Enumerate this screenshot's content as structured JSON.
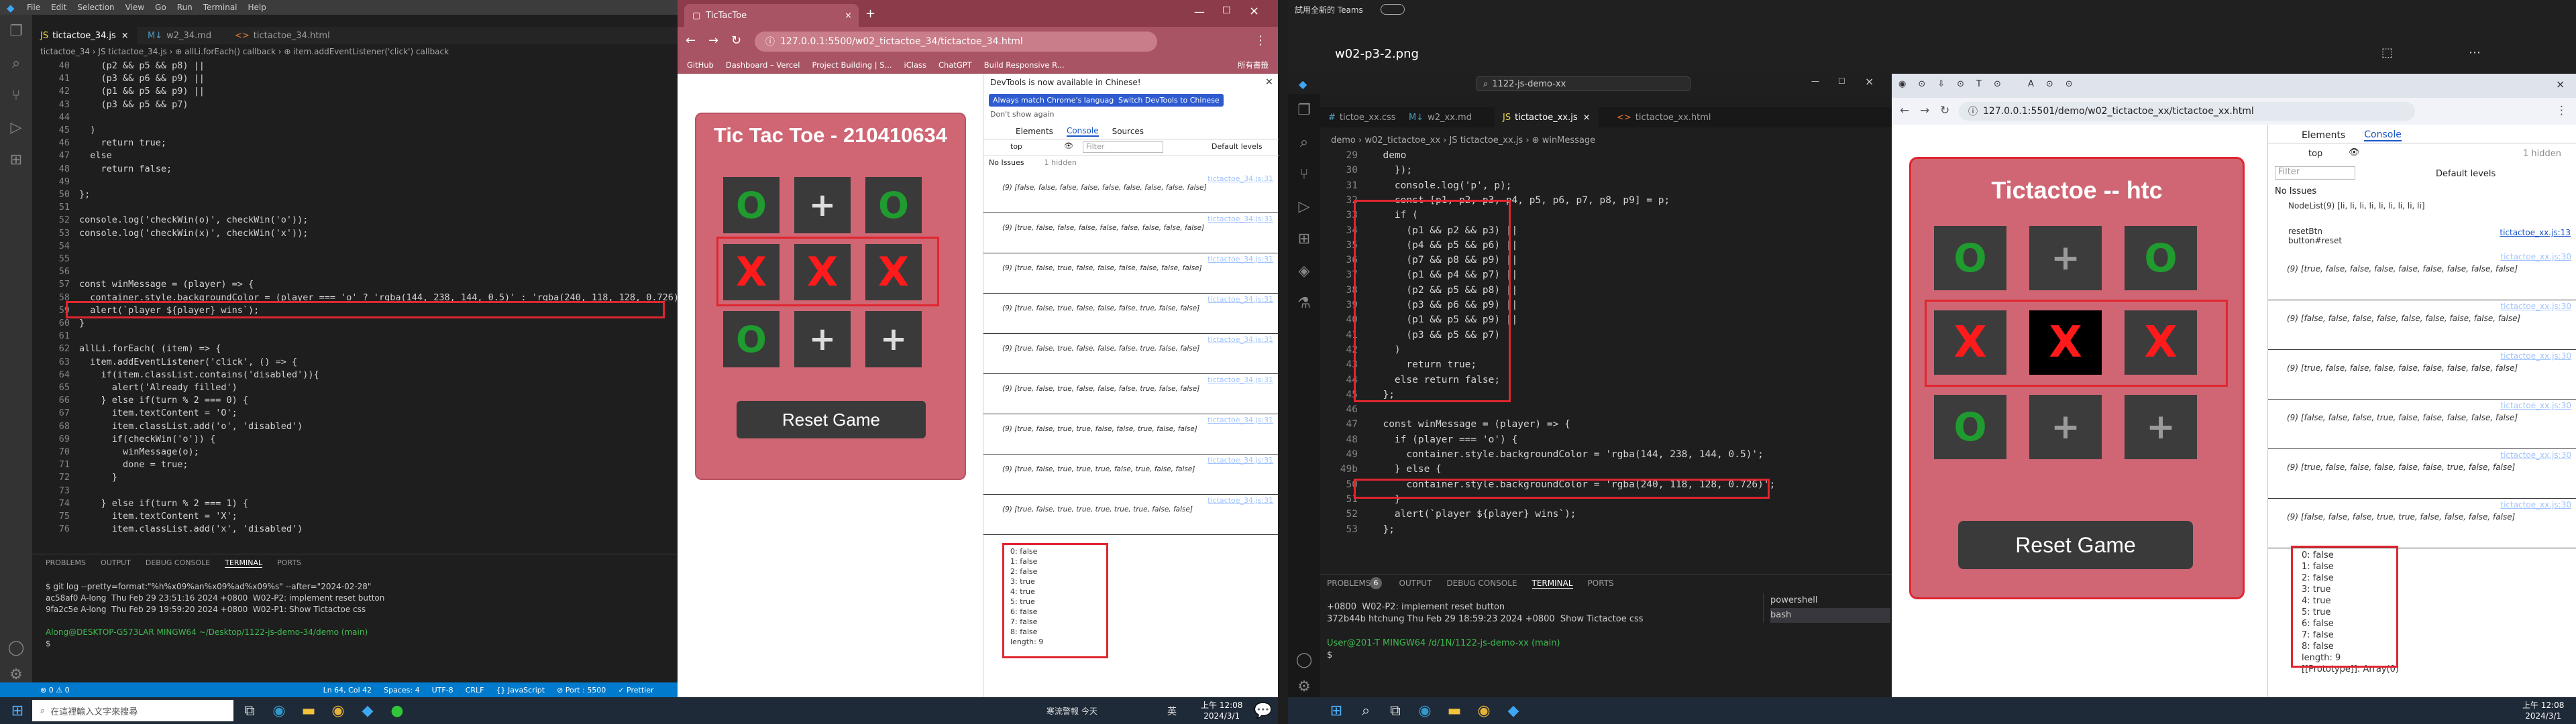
{
  "left_vscode": {
    "menu": [
      "File",
      "Edit",
      "Selection",
      "View",
      "Go",
      "Run",
      "Terminal",
      "Help"
    ],
    "tabs": [
      "tictactoe_34.js",
      "w2_34.md",
      "tictactoe_34.html"
    ],
    "breadcrumb": "tictactoe_34 › JS tictactoe_34.js › ⊕ allLi.forEach() callback › ⊕ item.addEventListener('click') callback",
    "code": [
      {
        "n": "40",
        "t": "    (p2 && p5 && p8) ||"
      },
      {
        "n": "41",
        "t": "    (p3 && p6 && p9) ||"
      },
      {
        "n": "42",
        "t": "    (p1 && p5 && p9) ||"
      },
      {
        "n": "43",
        "t": "    (p3 && p5 && p7)"
      },
      {
        "n": "44",
        "t": ""
      },
      {
        "n": "45",
        "t": "  ) "
      },
      {
        "n": "46",
        "t": "    return true;"
      },
      {
        "n": "47",
        "t": "  else"
      },
      {
        "n": "48",
        "t": "    return false;"
      },
      {
        "n": "49",
        "t": ""
      },
      {
        "n": "50",
        "t": "};"
      },
      {
        "n": "51",
        "t": ""
      },
      {
        "n": "52",
        "t": "console.log('checkWin(o)', checkWin('o'));"
      },
      {
        "n": "53",
        "t": "console.log('checkWin(x)', checkWin('x'));"
      },
      {
        "n": "54",
        "t": ""
      },
      {
        "n": "55",
        "t": ""
      },
      {
        "n": "56",
        "t": ""
      },
      {
        "n": "57",
        "t": "const winMessage = (player) => {"
      },
      {
        "n": "58",
        "t": "  container.style.backgroundColor = (player === 'o' ? 'rgba(144, 238, 144, 0.5)' : 'rgba(240, 118, 128, 0.726)'"
      },
      {
        "n": "59",
        "t": "  alert(`player ${player} wins`);"
      },
      {
        "n": "60",
        "t": "}"
      },
      {
        "n": "61",
        "t": ""
      },
      {
        "n": "62",
        "t": "allLi.forEach( (item) => {"
      },
      {
        "n": "63",
        "t": "  item.addEventListener('click', () => {"
      },
      {
        "n": "64",
        "t": "    if(item.classList.contains('disabled')){"
      },
      {
        "n": "65",
        "t": "      alert('Already filled')"
      },
      {
        "n": "66",
        "t": "    } else if(turn % 2 === 0) {"
      },
      {
        "n": "67",
        "t": "      item.textContent = 'O';"
      },
      {
        "n": "68",
        "t": "      item.classList.add('o', 'disabled')"
      },
      {
        "n": "69",
        "t": "      if(checkWin('o')) {"
      },
      {
        "n": "70",
        "t": "        winMessage(o);"
      },
      {
        "n": "71",
        "t": "        done = true;"
      },
      {
        "n": "72",
        "t": "      }"
      },
      {
        "n": "73",
        "t": ""
      },
      {
        "n": "74",
        "t": "    } else if(turn % 2 === 1) {"
      },
      {
        "n": "75",
        "t": "      item.textContent = 'X';"
      },
      {
        "n": "76",
        "t": "      item.classList.add('x', 'disabled')"
      }
    ],
    "panel_tabs": [
      "PROBLEMS",
      "OUTPUT",
      "DEBUG CONSOLE",
      "TERMINAL",
      "PORTS"
    ],
    "terminal": [
      "$ git log --pretty=format:\"%h%x09%an%x09%ad%x09%s\" --after=\"2024-02-28\"",
      "ac58af0 A-long  Thu Feb 29 23:51:16 2024 +0800  W02-P2: implement reset button",
      "9fa2c5e A-long  Thu Feb 29 19:59:20 2024 +0800  W02-P1: Show Tictactoe css",
      "",
      "Along@DESKTOP-G573LAR MINGW64 ~/Desktop/1122-js-demo-34/demo (main)",
      "$ "
    ],
    "status": [
      "⊗ 0 ⚠ 0",
      "Ln 64, Col 42",
      "Spaces: 4",
      "UTF-8",
      "CRLF",
      "{} JavaScript",
      "⊘ Port : 5500",
      "✓ Prettier"
    ]
  },
  "left_browser": {
    "tab_title": "TicTacToe",
    "url": "127.0.0.1:5500/w02_tictactoe_34/tictactoe_34.html",
    "bookmarks": [
      "GitHub",
      "Dashboard – Vercel",
      "Project Building | S...",
      "iClass",
      "ChatGPT",
      "Build Responsive R..."
    ],
    "bookmark_folder": "所有書籤",
    "game_title": "Tic Tac Toe - 210410634",
    "board": [
      "o",
      "p",
      "o",
      "x",
      "x",
      "x",
      "o",
      "p",
      "p"
    ],
    "reset_label": "Reset Game",
    "devtools_notice": "DevTools is now available in Chinese!",
    "devtools_btn1": "Always match Chrome's language",
    "devtools_btn2": "Switch DevTools to Chinese",
    "devtools_dont": "Don't show again",
    "devtools_tabs": [
      "Elements",
      "Console",
      "Sources"
    ],
    "filter_placeholder": "Filter",
    "default_levels": "Default levels",
    "no_issues": "No Issues",
    "hidden": "1 hidden",
    "top": "top",
    "source": "tictactoe_34.js:31",
    "logs": [
      "(9) [false, false, false, false, false, false, false, false, false]",
      "(9) [true, false, false, false, false, false, false, false, false]",
      "(9) [true, false, true, false, false, false, false, false, false]",
      "(9) [true, false, true, false, false, false, true, false, false]",
      "(9) [true, false, true, false, false, false, true, false, false]",
      "(9) [true, false, true, false, false, false, true, false, false]",
      "(9) [true, false, true, true, false, false, true, false, false]",
      "(9) [true, false, true, true, true, false, true, false, false]",
      "(9) [true, false, true, true, true, true, true, false, false]"
    ],
    "expanded": [
      "0: false",
      "1: false",
      "2: false",
      "3: true",
      "4: true",
      "5: true",
      "6: false",
      "7: false",
      "8: false",
      "length: 9"
    ]
  },
  "right_vscode": {
    "title": "w02-p3-2.png",
    "search": "1122-js-demo-xx",
    "tabs": [
      "tictoe_xx.css",
      "w2_xx.md",
      "tictactoe_xx.js",
      "tictactoe_xx.html"
    ],
    "breadcrumb": "demo › w02_tictactoe_xx › JS tictactoe_xx.js › ⊕ winMessage",
    "code": [
      {
        "n": "29",
        "t": "  demo"
      },
      {
        "n": "30",
        "t": "    });"
      },
      {
        "n": "31",
        "t": "    console.log('p', p);"
      },
      {
        "n": "32",
        "t": "    const [p1, p2, p3, p4, p5, p6, p7, p8, p9] = p;"
      },
      {
        "n": "33",
        "t": "    if ("
      },
      {
        "n": "34",
        "t": "      (p1 && p2 && p3) ||"
      },
      {
        "n": "35",
        "t": "      (p4 && p5 && p6) ||"
      },
      {
        "n": "36",
        "t": "      (p7 && p8 && p9) ||"
      },
      {
        "n": "37",
        "t": "      (p1 && p4 && p7) ||"
      },
      {
        "n": "38",
        "t": "      (p2 && p5 && p8) ||"
      },
      {
        "n": "39",
        "t": "      (p3 && p6 && p9) ||"
      },
      {
        "n": "40",
        "t": "      (p1 && p5 && p9) ||"
      },
      {
        "n": "41",
        "t": "      (p3 && p5 && p7)"
      },
      {
        "n": "42",
        "t": "    )"
      },
      {
        "n": "43",
        "t": "      return true;"
      },
      {
        "n": "44",
        "t": "    else return false;"
      },
      {
        "n": "45",
        "t": "  };"
      },
      {
        "n": "46",
        "t": ""
      },
      {
        "n": "47",
        "t": "  const winMessage = (player) => {"
      },
      {
        "n": "48",
        "t": "    if (player === 'o') {"
      },
      {
        "n": "49",
        "t": "      container.style.backgroundColor = 'rgba(144, 238, 144, 0.5)';"
      },
      {
        "n": "49b",
        "t": "    } else {"
      },
      {
        "n": "50",
        "t": "      container.style.backgroundColor = 'rgba(240, 118, 128, 0.726)';"
      },
      {
        "n": "51",
        "t": "    }"
      },
      {
        "n": "52",
        "t": "    alert(`player ${player} wins`);"
      },
      {
        "n": "53",
        "t": "  };"
      }
    ],
    "panel_tabs": [
      "PROBLEMS",
      "OUTPUT",
      "DEBUG CONSOLE",
      "TERMINAL",
      "PORTS"
    ],
    "problems_count": "6",
    "terminal": [
      "+0800  W02-P2: implement reset button",
      "372b44b htchung Thu Feb 29 18:59:23 2024 +0800  Show Tictactoe css",
      "",
      "User@201-T MINGW64 /d/1N/1122-js-demo-xx (main)",
      "$ "
    ],
    "shells": [
      "powershell",
      "bash"
    ]
  },
  "right_browser": {
    "url": "127.0.0.1:5501/demo/w02_tictactoe_xx/tictactoe_xx.html",
    "game_title": "Tictactoe -- htc",
    "board": [
      "o",
      "p",
      "o",
      "x",
      "x",
      "x",
      "o",
      "p",
      "p"
    ],
    "reset_label": "Reset Game",
    "devtools_tabs": [
      "Elements",
      "Console"
    ],
    "filter_placeholder": "Filter",
    "default_levels": "Default levels",
    "hidden": "1 hidden",
    "no_issues": "No Issues",
    "top": "top",
    "reset_label_log": "resetBtn",
    "reset_log2": "button#reset",
    "source": "tictactoe_xx.js:30",
    "source13": "tictactoe_xx.js:13",
    "first_log": "NodeList(9) [li, li, li, li, li, li, li, li, li]",
    "logs": [
      "(9) [true, false, false, false, false, false, false, false, false]",
      "(9) [false, false, false, false, false, false, false, false, false]",
      "(9) [true, false, false, false, false, false, false, false, false]",
      "(9) [false, false, false, true, false, false, false, false, false]",
      "(9) [true, false, false, false, false, false, true, false, false]",
      "(9) [false, false, false, true, true, false, false, false, false]"
    ],
    "expanded": [
      "0: false",
      "1: false",
      "2: false",
      "3: true",
      "4: true",
      "5: true",
      "6: false",
      "7: false",
      "8: false",
      "length: 9",
      "[[Prototype]]: Array(0)"
    ]
  },
  "top_right": {
    "label": "試用全新的 Teams"
  },
  "taskbar": {
    "search_placeholder": "在這裡輸入文字來搜尋",
    "left_time": "上午 12:08",
    "left_date": "2024/3/1",
    "left_lang": "英",
    "left_weather": "寒流警報 今天",
    "right_time": "上午 12:08",
    "right_date": "2024/3/1"
  }
}
